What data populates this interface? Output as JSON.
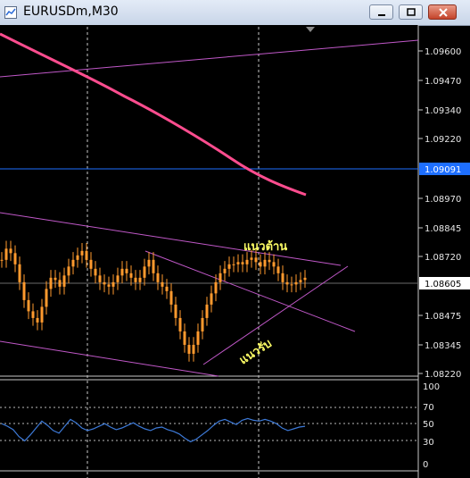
{
  "window": {
    "title": "EURUSDm,M30",
    "buttons": [
      "minimize-icon",
      "restore-icon",
      "close-icon"
    ]
  },
  "chart_data": {
    "type": "candlestick",
    "symbol": "EURUSDm",
    "timeframe": "M30",
    "price_axis": {
      "labels": [
        "1.09600",
        "1.09470",
        "1.09340",
        "1.09220",
        "1.08970",
        "1.08845",
        "1.08720",
        "1.08475",
        "1.08345",
        "1.08220"
      ],
      "ylim": [
        1.0816,
        1.0973
      ]
    },
    "markers": {
      "blue_line": {
        "price": "1.09091",
        "value": 1.09091,
        "color": "#1e6fff"
      },
      "current_price": {
        "price": "1.08605",
        "value": 1.08605,
        "color": "#c8c8c8"
      }
    },
    "candles_close_approx": [
      1.0868,
      1.0873,
      1.0871,
      1.0866,
      1.0858,
      1.085,
      1.0845,
      1.0842,
      1.084,
      1.0847,
      1.0855,
      1.086,
      1.0859,
      1.0856,
      1.0861,
      1.0865,
      1.0868,
      1.087,
      1.0872,
      1.0868,
      1.0864,
      1.0861,
      1.0858,
      1.0857,
      1.0856,
      1.0858,
      1.0861,
      1.0864,
      1.0862,
      1.086,
      1.0858,
      1.086,
      1.0865,
      1.0868,
      1.0862,
      1.0858,
      1.0856,
      1.0854,
      1.0848,
      1.0842,
      1.0836,
      1.083,
      1.0826,
      1.083,
      1.0836,
      1.0842,
      1.0848,
      1.0853,
      1.0858,
      1.0862,
      1.0864,
      1.0866,
      1.0866,
      1.0867,
      1.0866,
      1.0868,
      1.0869,
      1.0867,
      1.0865,
      1.0868,
      1.0867,
      1.0865,
      1.0862,
      1.0858,
      1.0857,
      1.0857,
      1.0858,
      1.0859,
      1.086
    ],
    "annotations": [
      {
        "text": "แนวต้าน",
        "color": "#ffff66"
      },
      {
        "text": "แนวรับ",
        "color": "#ffff66"
      }
    ],
    "indicator": {
      "axis_labels": [
        "100",
        "70",
        "50",
        "30",
        "0"
      ],
      "levels": [
        70,
        50,
        30
      ],
      "ylim": [
        0,
        100
      ],
      "values": [
        55,
        52,
        48,
        40,
        35,
        42,
        50,
        58,
        53,
        47,
        44,
        52,
        60,
        56,
        50,
        47,
        49,
        52,
        55,
        51,
        48,
        50,
        53,
        56,
        52,
        49,
        47,
        50,
        51,
        48,
        46,
        43,
        38,
        34,
        37,
        42,
        47,
        53,
        58,
        60,
        57,
        54,
        59,
        61,
        59,
        58,
        60,
        58,
        55,
        50,
        47,
        49,
        51,
        52
      ]
    },
    "colors": {
      "background": "#000000",
      "candles": "#ff9a2e",
      "ma_line": "#ff4d8f",
      "trendlines": "#c058c8",
      "grid_vertical": "#c8c8c8",
      "indicator_line": "#3d7ad8"
    }
  }
}
